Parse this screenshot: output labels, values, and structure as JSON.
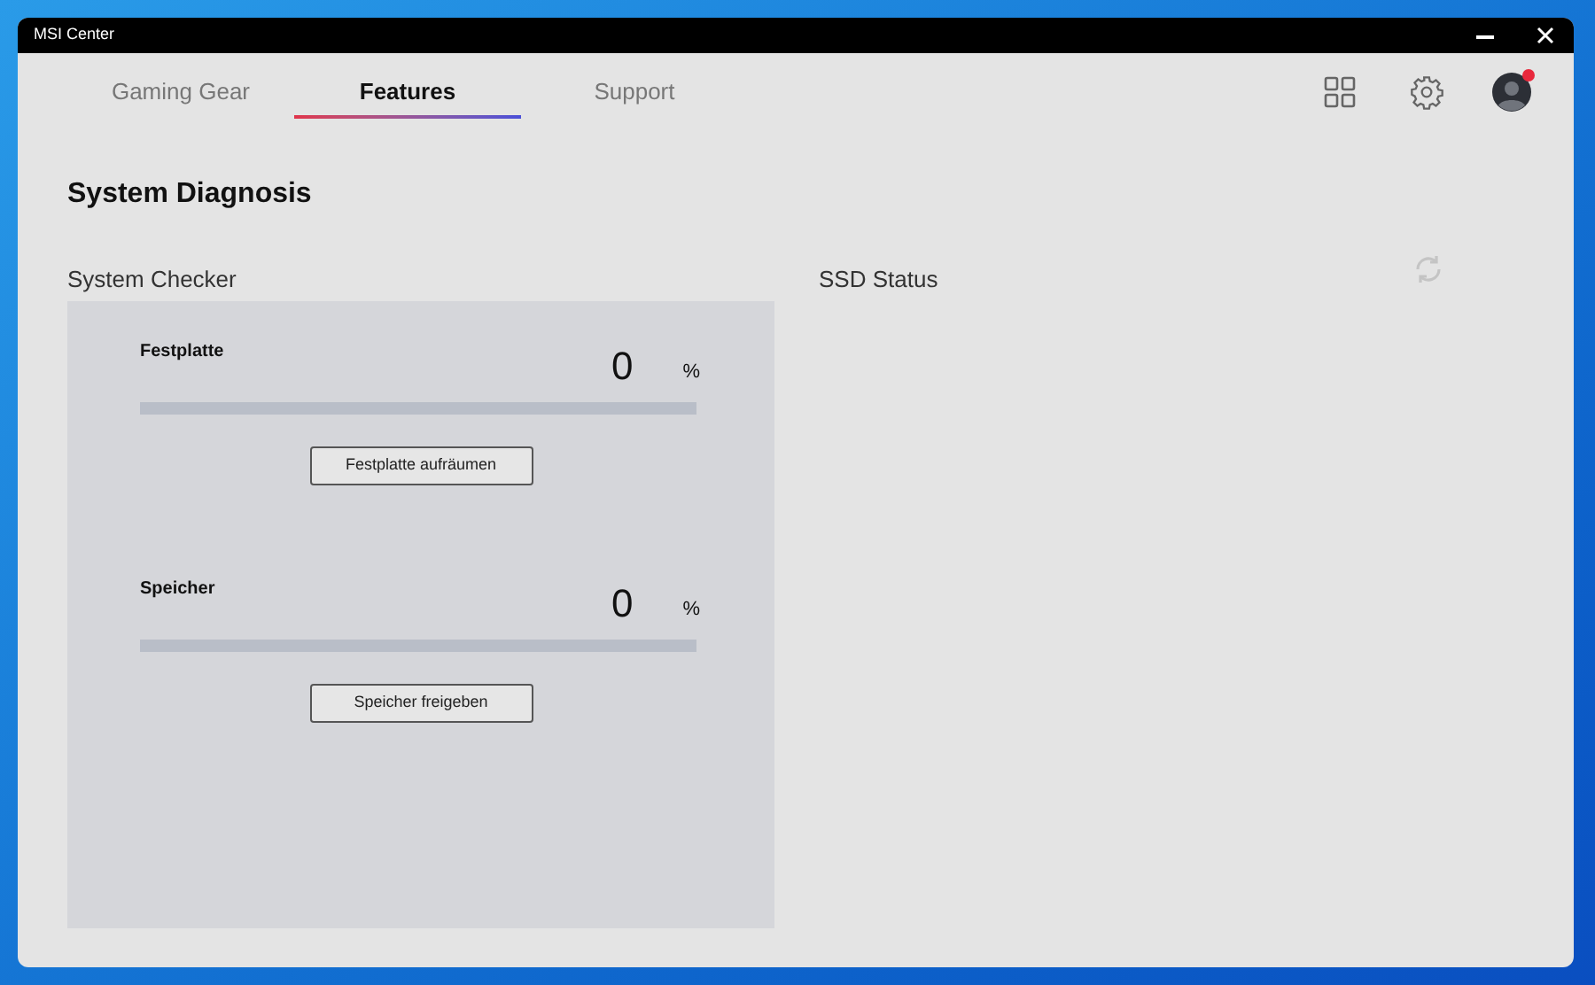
{
  "window": {
    "title": "MSI Center"
  },
  "tabs": [
    {
      "label": "Gaming Gear",
      "selected": false
    },
    {
      "label": "Features",
      "selected": true
    },
    {
      "label": "Support",
      "selected": false
    }
  ],
  "notification": true,
  "page_title": "System Diagnosis",
  "system_checker": {
    "title": "System Checker",
    "items": [
      {
        "label": "Festplatte",
        "value": "0",
        "unit": "%",
        "button": "Festplatte aufräumen"
      },
      {
        "label": "Speicher",
        "value": "0",
        "unit": "%",
        "button": "Speicher freigeben"
      }
    ]
  },
  "ssd_status": {
    "title": "SSD Status"
  }
}
